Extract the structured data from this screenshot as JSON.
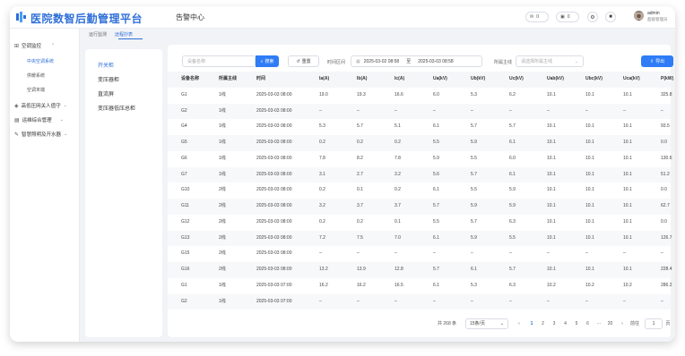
{
  "brand": {
    "title": "医院数智后勤管理平台"
  },
  "module_title": "告警中心",
  "header": {
    "badge1_count": "0",
    "badge2_count": "0",
    "user_name": "admin",
    "user_role": "超级管理员"
  },
  "sidebar": {
    "groups": [
      {
        "label": "空调监控",
        "expanded": true,
        "items": [
          "中央空调系统",
          "供暖系统",
          "空调末端"
        ]
      },
      {
        "label": "高低压网关人值守",
        "expanded": false,
        "items": []
      },
      {
        "label": "运维综合管理",
        "expanded": false,
        "items": []
      },
      {
        "label": "智慧照明及开水器",
        "expanded": false,
        "items": []
      }
    ],
    "active_item": "中央空调系统"
  },
  "breadcrumb": {
    "parent": "运行监测",
    "current": "远程抄表"
  },
  "cabinets": {
    "items": [
      "开关柜",
      "变压器柜",
      "直流屏",
      "变压器低压总柜"
    ],
    "active": "开关柜"
  },
  "filters": {
    "device_placeholder": "设备名称",
    "search_label": "搜索",
    "reset_label": "重置",
    "time_label": "时间区间",
    "start_time": "2025-03-02 08:58",
    "range_sep": "至",
    "end_time": "2025-03-03 08:58",
    "busbar_label": "所属主线",
    "busbar_placeholder": "请选择所属主线",
    "export_label": "导出"
  },
  "table": {
    "columns": [
      "设备名称",
      "所属主线",
      "时间",
      "Ia(A)",
      "Ib(A)",
      "Ic(A)",
      "Ua(kV)",
      "Ub(kV)",
      "Uc(kV)",
      "Uab(kV)",
      "Ubc(kV)",
      "Uca(kV)",
      "P(kW)"
    ],
    "rows": [
      [
        "G1",
        "1线",
        "2025-03-03 08:00",
        "19.0",
        "19.3",
        "16.6",
        "6.0",
        "5.3",
        "6.2",
        "10.1",
        "10.1",
        "10.1",
        "325.8"
      ],
      [
        "G2",
        "1线",
        "2025-03-03 08:00",
        "–",
        "–",
        "–",
        "–",
        "–",
        "–",
        "–",
        "–",
        "–",
        "–"
      ],
      [
        "G4",
        "1线",
        "2025-03-03 08:00",
        "5.3",
        "5.7",
        "5.1",
        "6.1",
        "5.7",
        "5.7",
        "10.1",
        "10.1",
        "10.1",
        "93.5"
      ],
      [
        "G5",
        "1线",
        "2025-03-03 08:00",
        "0.2",
        "0.2",
        "0.2",
        "5.5",
        "5.9",
        "6.1",
        "10.1",
        "10.1",
        "10.1",
        "0.0"
      ],
      [
        "G6",
        "1线",
        "2025-03-03 08:00",
        "7.8",
        "8.2",
        "7.8",
        "5.9",
        "5.5",
        "6.0",
        "10.1",
        "10.1",
        "10.1",
        "130.6"
      ],
      [
        "G7",
        "1线",
        "2025-03-03 08:00",
        "3.1",
        "2.7",
        "3.2",
        "5.6",
        "5.7",
        "6.1",
        "10.1",
        "10.1",
        "10.1",
        "51.2"
      ],
      [
        "G10",
        "2线",
        "2025-03-03 08:00",
        "0.2",
        "0.1",
        "0.2",
        "6.1",
        "5.5",
        "5.9",
        "10.1",
        "10.1",
        "10.1",
        "0.0"
      ],
      [
        "G11",
        "2线",
        "2025-03-03 08:00",
        "3.2",
        "3.7",
        "3.7",
        "5.7",
        "5.9",
        "5.9",
        "10.1",
        "10.1",
        "10.1",
        "62.7"
      ],
      [
        "G12",
        "2线",
        "2025-03-03 08:00",
        "0.2",
        "0.2",
        "0.1",
        "5.5",
        "5.7",
        "6.3",
        "10.1",
        "10.1",
        "10.1",
        "0.0"
      ],
      [
        "G13",
        "2线",
        "2025-03-03 08:00",
        "7.2",
        "7.5",
        "7.0",
        "6.1",
        "5.9",
        "5.5",
        "10.1",
        "10.1",
        "10.1",
        "126.7"
      ],
      [
        "G15",
        "2线",
        "2025-03-03 08:00",
        "–",
        "–",
        "–",
        "–",
        "–",
        "–",
        "–",
        "–",
        "–",
        "–"
      ],
      [
        "G16",
        "2线",
        "2025-03-03 08:00",
        "13.2",
        "13.9",
        "12.8",
        "5.7",
        "6.1",
        "5.7",
        "10.1",
        "10.1",
        "10.1",
        "228.4"
      ],
      [
        "G1",
        "1线",
        "2025-03-03 07:00",
        "16.2",
        "16.2",
        "16.5",
        "6.1",
        "5.3",
        "6.3",
        "10.2",
        "10.2",
        "10.2",
        "286.2"
      ],
      [
        "G2",
        "1线",
        "2025-03-03 07:00",
        "–",
        "–",
        "–",
        "–",
        "–",
        "–",
        "–",
        "–",
        "–",
        "–"
      ]
    ]
  },
  "pagination": {
    "total": "共 268 条",
    "page_size": "15条/页",
    "pages": [
      "1",
      "2",
      "3",
      "4",
      "5",
      "6",
      "···",
      "20"
    ],
    "current": "1",
    "goto_label": "前往",
    "goto_value": "1",
    "page_unit": "页"
  },
  "colors": {
    "primary": "#2f7cf6",
    "brand": "#2f6fd8"
  }
}
